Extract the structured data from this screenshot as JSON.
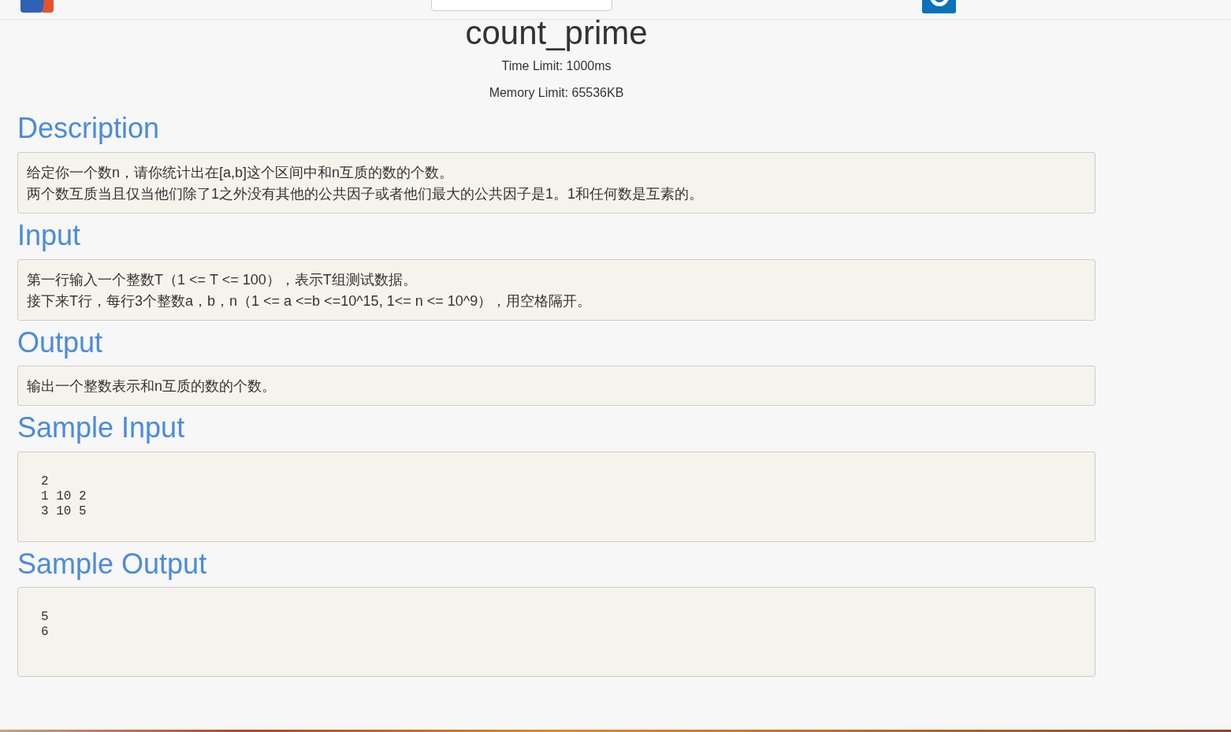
{
  "problem": {
    "title": "count_prime",
    "limits": [
      "Time Limit: 1000ms",
      "Memory Limit: 65536KB"
    ]
  },
  "sections": [
    {
      "heading": "Description",
      "kind": "text",
      "lines": [
        "给定你一个数n，请你统计出在[a,b]这个区间中和n互质的数的个数。",
        "两个数互质当且仅当他们除了1之外没有其他的公共因子或者他们最大的公共因子是1。1和任何数是互素的。"
      ]
    },
    {
      "heading": "Input",
      "kind": "text",
      "lines": [
        "第一行输入一个整数T（1 <= T <= 100），表示T组测试数据。",
        "接下来T行，每行3个整数a，b，n（1 <= a <=b <=10^15, 1<= n <= 10^9），用空格隔开。"
      ]
    },
    {
      "heading": "Output",
      "kind": "text",
      "lines": [
        "输出一个整数表示和n互质的数的个数。"
      ]
    },
    {
      "heading": "Sample Input",
      "kind": "code",
      "lines": [
        "2",
        "1 10 2",
        "3 10 5"
      ]
    },
    {
      "heading": "Sample Output",
      "kind": "code",
      "lines": [
        "5",
        "6"
      ]
    }
  ]
}
